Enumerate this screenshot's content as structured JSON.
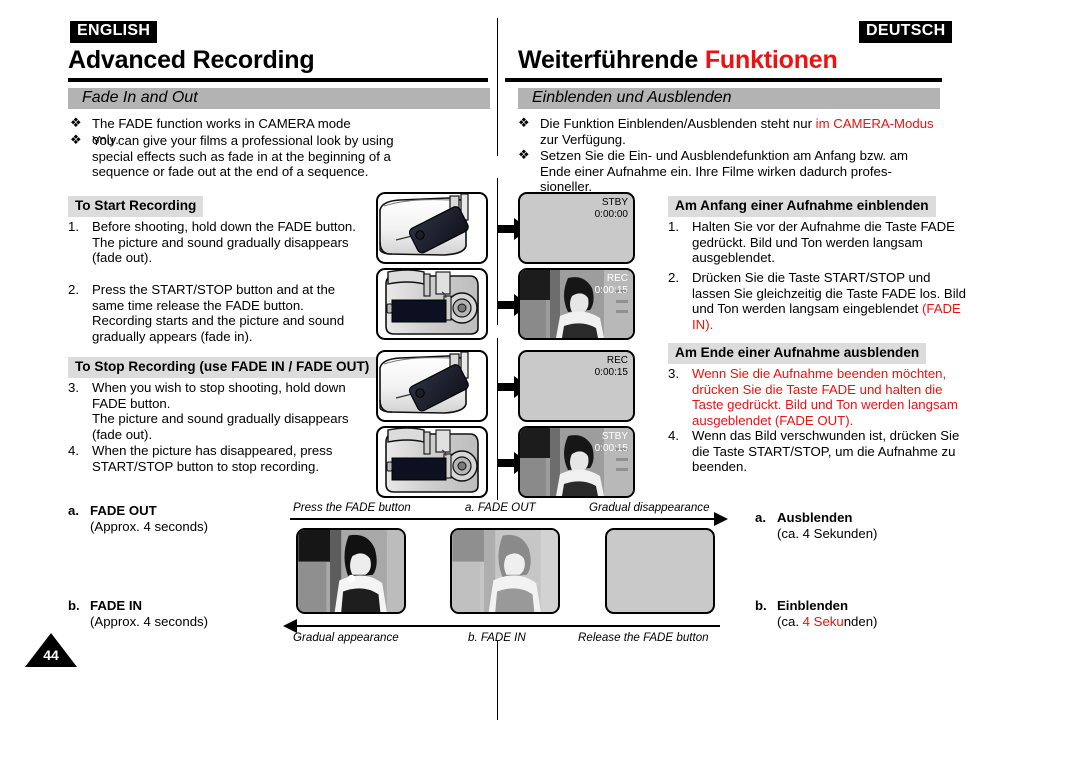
{
  "page": {
    "number": "44"
  },
  "left": {
    "language_badge": "ENGLISH",
    "chapter_title": "Advanced Recording",
    "section_title": "Fade In and Out",
    "bullets": [
      "The FADE function works in CAMERA mode only.",
      "You can give your films a professional look by using special effects such as fade in at the beginning of a sequence or fade out at the end of a sequence."
    ],
    "start_heading": "To Start Recording",
    "steps_start": [
      {
        "n": "1.",
        "text": "Before shooting, hold down the FADE button.\nThe picture and sound gradually disappears (fade out)."
      },
      {
        "n": "2.",
        "text": "Press the START/STOP button and at the same time release the FADE button.\nRecording starts and the picture and sound gradually appears (fade in)."
      }
    ],
    "stop_heading": "To Stop Recording (use FADE IN / FADE OUT)",
    "steps_stop": [
      {
        "n": "3.",
        "text": "When you wish to stop shooting, hold down FADE button.\nThe picture and sound gradually disappears (fade out)."
      },
      {
        "n": "4.",
        "text": "When the picture has disappeared, press START/STOP button to stop recording."
      }
    ],
    "legend": [
      {
        "letter": "a.",
        "head": "FADE OUT",
        "sub": "(Approx. 4 seconds)"
      },
      {
        "letter": "b.",
        "head": "FADE IN",
        "sub": "(Approx. 4 seconds)"
      }
    ]
  },
  "right": {
    "language_badge": "DEUTSCH",
    "chapter_title_black": "Weiterführende ",
    "chapter_title_red": "Funktionen",
    "section_title": "Einblenden und Ausblenden",
    "bullet1_black": "Die Funktion Einblenden/Ausblenden steht nur ",
    "bullet1_red": "im CAMERA-Modus",
    "bullet1_tail": "zur Verfügung.",
    "bullet2": "Setzen Sie die Ein- und Ausblendefunktion am Anfang bzw. am Ende einer Aufnahme ein. Ihre Filme wirken dadurch profes-sioneller.",
    "start_heading": "Am Anfang einer Aufnahme einblenden",
    "steps_start": [
      {
        "n": "1.",
        "text": "Halten Sie vor der Aufnahme die Taste FADE gedrückt. Bild und Ton werden langsam ausgeblendet."
      },
      {
        "n": "2.",
        "text": "Drücken Sie die Taste START/STOP und lassen Sie gleichzeitig die Taste FADE los. Bild und Ton werden langsam eingeblendet ",
        "red_tail": "(FADE IN)."
      }
    ],
    "stop_heading": "Am Ende einer Aufnahme ausblenden",
    "steps_stop": [
      {
        "n": "3.",
        "text": "Wenn Sie die Aufnahme beenden möchten, drücken Sie die Taste FADE und halten die Taste gedrückt. Bild und Ton werden langsam ausgeblendet (FADE OUT).",
        "all_red": true
      },
      {
        "n": "4.",
        "text": "Wenn das Bild verschwunden ist, drücken Sie die Taste START/STOP, um die Aufnahme zu beenden.",
        "all_red": false
      }
    ],
    "legend": [
      {
        "letter": "a.",
        "head": "Ausblenden",
        "sub_pre": "(ca. 4 Sekunden)"
      },
      {
        "letter": "b.",
        "head": "Einblenden",
        "sub_pre": "(ca. ",
        "sub_red": "4 Seku",
        "sub_post": "nden)"
      }
    ]
  },
  "illustration": {
    "lcd_screens": [
      {
        "status": "STBY",
        "time": "0:00:00",
        "dark": false
      },
      {
        "status": "REC",
        "time": "0:00:15",
        "dark": true
      },
      {
        "status": "REC",
        "time": "0:00:15",
        "dark": false
      },
      {
        "status": "STBY",
        "time": "0:00:15",
        "dark": true
      }
    ]
  },
  "strip": {
    "top_left": "Press the FADE button",
    "top_center": "a. FADE OUT",
    "top_right": "Gradual disappearance",
    "bottom_left": "Gradual appearance",
    "bottom_center": "b. FADE IN",
    "bottom_right": "Release the FADE button"
  },
  "colors": {
    "accent_red": "#ee1111",
    "section_bar": "#b3b3b3",
    "chip_bar": "#dcdcdc",
    "badge": "#000000"
  }
}
